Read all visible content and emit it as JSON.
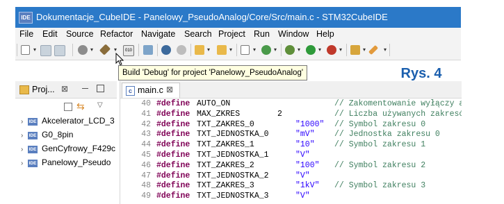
{
  "title_bar": {
    "app_badge": "IDE",
    "title": "Dokumentacje_CubeIDE - Panelowy_PseudoAnalog/Core/Src/main.c - STM32CubeIDE"
  },
  "menu": [
    "File",
    "Edit",
    "Source",
    "Refactor",
    "Navigate",
    "Search",
    "Project",
    "Run",
    "Window",
    "Help"
  ],
  "toolbar": {
    "tooltip": "Build 'Debug' for project 'Panelowy_PseudoAnalog'",
    "icons": [
      "new-file-icon",
      "save-icon",
      "save-all-icon",
      "settings-icon",
      "build-hammer-icon",
      "binary-icon",
      "debug-config-icon",
      "manage-icon",
      "refresh-icon",
      "new-project-icon",
      "folder-icon",
      "new-class-icon",
      "new-c-file-icon",
      "debug-icon",
      "run-icon",
      "external-tools-icon",
      "open-perspective-icon",
      "pencil-icon"
    ]
  },
  "figure_label": "Rys. 4",
  "project_explorer": {
    "tab_label": "Proj...",
    "close_symbol": "⊠",
    "items": [
      {
        "label": "Akcelerator_LCD_3",
        "badge": "IDE"
      },
      {
        "label": "G0_8pin",
        "badge": "IDE"
      },
      {
        "label": "GenCyfrowy_F429c",
        "badge": "IDE"
      },
      {
        "label": "Panelowy_Pseudo",
        "badge": "IDE"
      }
    ]
  },
  "editor": {
    "tab_label": "main.c",
    "tab_badge": "c",
    "close_symbol": "⊠",
    "lines": [
      {
        "num": "40",
        "kw": "#define",
        "macro": "AUTO_ON",
        "value": "",
        "value_type": "none",
        "comment": "// Zakomentowanie wyłączy a"
      },
      {
        "num": "41",
        "kw": "#define",
        "macro": "MAX_ZKRES",
        "value": "2",
        "value_type": "number",
        "comment": "// Liczba używanych zakresó"
      },
      {
        "num": "42",
        "kw": "#define",
        "macro": "TXT_ZAKRES_0",
        "value": "\"1000\"",
        "value_type": "string",
        "comment": "// Symbol zakresu 0"
      },
      {
        "num": "43",
        "kw": "#define",
        "macro": "TXT_JEDNOSTKA_0",
        "value": "\"mV\"",
        "value_type": "string",
        "comment": "// Jednostka zakresu 0"
      },
      {
        "num": "44",
        "kw": "#define",
        "macro": "TXT_ZAKRES_1",
        "value": "\"10\"",
        "value_type": "string",
        "comment": "// Symbol zakresu 1"
      },
      {
        "num": "45",
        "kw": "#define",
        "macro": "TXT_JEDNOSTKA_1",
        "value": "\"V\"",
        "value_type": "string",
        "comment": ""
      },
      {
        "num": "46",
        "kw": "#define",
        "macro": "TXT_ZAKRES_2",
        "value": "\"100\"",
        "value_type": "string",
        "comment": "// Symbol zakresu 2"
      },
      {
        "num": "47",
        "kw": "#define",
        "macro": "TXT_JEDNOSTKA_2",
        "value": "\"V\"",
        "value_type": "string",
        "comment": ""
      },
      {
        "num": "48",
        "kw": "#define",
        "macro": "TXT_ZAKRES_3",
        "value": "\"1kV\"",
        "value_type": "string",
        "comment": "// Symbol zakresu 3"
      },
      {
        "num": "49",
        "kw": "#define",
        "macro": "TXT_JEDNOSTKA_3",
        "value": "\"V\"",
        "value_type": "string",
        "comment": ""
      }
    ]
  },
  "colors": {
    "title_bar": "#2b79c8",
    "keyword": "#7f0055",
    "string": "#2a00ff",
    "comment": "#3f7f5f",
    "figure_label": "#1b5fae"
  }
}
